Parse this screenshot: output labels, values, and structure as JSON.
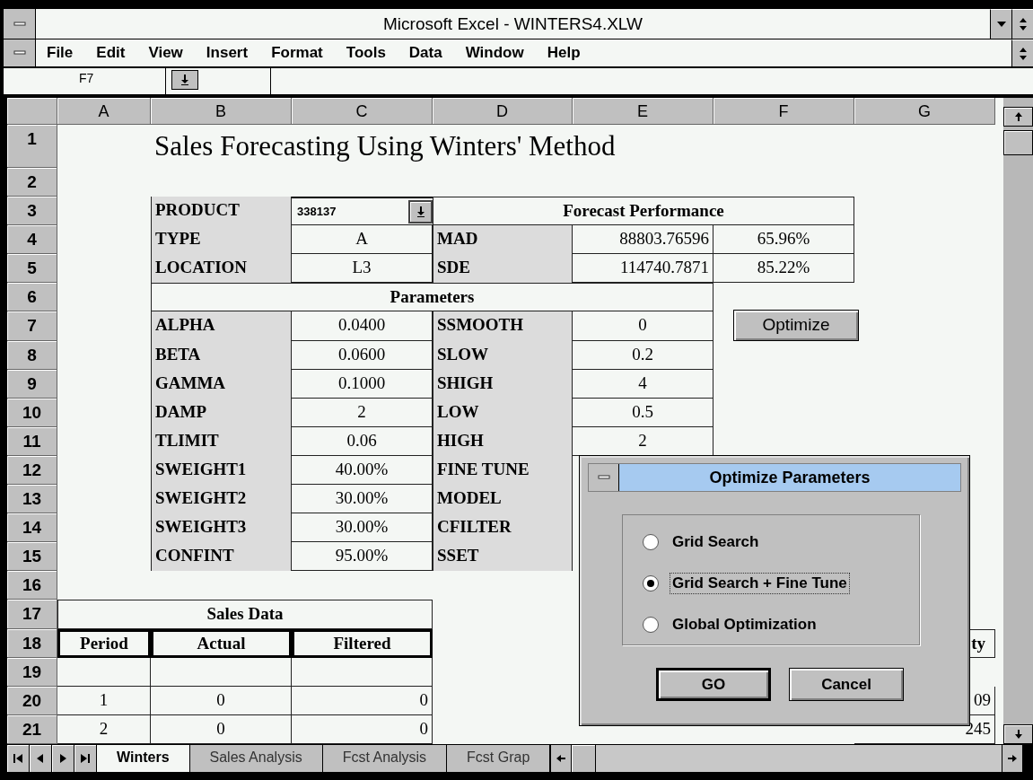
{
  "window": {
    "title": "Microsoft Excel - WINTERS4.XLW"
  },
  "menu": [
    "File",
    "Edit",
    "View",
    "Insert",
    "Format",
    "Tools",
    "Data",
    "Window",
    "Help"
  ],
  "formula_bar": {
    "name_box": "F7"
  },
  "sheet": {
    "columns": [
      "A",
      "B",
      "C",
      "D",
      "E",
      "F",
      "G"
    ],
    "rows": [
      {
        "number": "1",
        "cells": [
          {
            "kind": "empty"
          },
          {
            "kind": "title",
            "text": "Sales Forecasting Using Winters' Method"
          },
          {
            "kind": "merged"
          },
          {
            "kind": "merged"
          },
          {
            "kind": "merged"
          }
        ]
      },
      {
        "number": "2"
      },
      {
        "number": "3",
        "cells": [
          {
            "kind": "empty"
          },
          {
            "kind": "label",
            "text": "PRODUCT"
          },
          {
            "kind": "product",
            "text": "338137"
          },
          {
            "kind": "heading",
            "text": "Forecast Performance"
          },
          {
            "kind": "merged"
          },
          {
            "kind": "merged"
          }
        ]
      },
      {
        "number": "4",
        "cells": [
          {
            "kind": "empty"
          },
          {
            "kind": "label",
            "text": "TYPE"
          },
          {
            "kind": "value",
            "text": "A"
          },
          {
            "kind": "label",
            "text": "MAD"
          },
          {
            "kind": "number",
            "text": "88803.76596"
          },
          {
            "kind": "value",
            "text": "65.96%"
          }
        ]
      },
      {
        "number": "5",
        "cells": [
          {
            "kind": "empty"
          },
          {
            "kind": "label",
            "text": "LOCATION"
          },
          {
            "kind": "value",
            "text": "L3"
          },
          {
            "kind": "label",
            "text": "SDE"
          },
          {
            "kind": "number",
            "text": "114740.7871"
          },
          {
            "kind": "value",
            "text": "85.22%"
          }
        ]
      },
      {
        "number": "6",
        "cells": [
          {
            "kind": "empty"
          },
          {
            "kind": "heading",
            "text": "Parameters"
          },
          {
            "kind": "merged"
          },
          {
            "kind": "merged"
          },
          {
            "kind": "merged"
          }
        ]
      },
      {
        "number": "7",
        "cells": [
          {
            "kind": "empty"
          },
          {
            "kind": "label",
            "text": "ALPHA"
          },
          {
            "kind": "value",
            "text": "0.0400"
          },
          {
            "kind": "label",
            "text": "SSMOOTH"
          },
          {
            "kind": "value",
            "text": "0"
          },
          {
            "kind": "button",
            "text": "Optimize"
          }
        ]
      },
      {
        "number": "8",
        "cells": [
          {
            "kind": "empty"
          },
          {
            "kind": "label",
            "text": "BETA"
          },
          {
            "kind": "value",
            "text": "0.0600"
          },
          {
            "kind": "label",
            "text": "SLOW"
          },
          {
            "kind": "value",
            "text": "0.2"
          }
        ]
      },
      {
        "number": "9",
        "cells": [
          {
            "kind": "empty"
          },
          {
            "kind": "label",
            "text": "GAMMA"
          },
          {
            "kind": "value",
            "text": "0.1000"
          },
          {
            "kind": "label",
            "text": "SHIGH"
          },
          {
            "kind": "value",
            "text": "4"
          }
        ]
      },
      {
        "number": "10",
        "cells": [
          {
            "kind": "empty"
          },
          {
            "kind": "label",
            "text": "DAMP"
          },
          {
            "kind": "value",
            "text": "2"
          },
          {
            "kind": "label",
            "text": "LOW"
          },
          {
            "kind": "value",
            "text": "0.5"
          }
        ]
      },
      {
        "number": "11",
        "cells": [
          {
            "kind": "empty"
          },
          {
            "kind": "label",
            "text": "TLIMIT"
          },
          {
            "kind": "value",
            "text": "0.06"
          },
          {
            "kind": "label",
            "text": "HIGH"
          },
          {
            "kind": "value",
            "text": "2"
          }
        ]
      },
      {
        "number": "12",
        "cells": [
          {
            "kind": "empty"
          },
          {
            "kind": "label",
            "text": "SWEIGHT1"
          },
          {
            "kind": "value",
            "text": "40.00%"
          },
          {
            "kind": "label",
            "text": "FINE TUNE"
          }
        ]
      },
      {
        "number": "13",
        "cells": [
          {
            "kind": "empty"
          },
          {
            "kind": "label",
            "text": "SWEIGHT2"
          },
          {
            "kind": "value",
            "text": "30.00%"
          },
          {
            "kind": "label",
            "text": "MODEL"
          }
        ]
      },
      {
        "number": "14",
        "cells": [
          {
            "kind": "empty"
          },
          {
            "kind": "label",
            "text": "SWEIGHT3"
          },
          {
            "kind": "value",
            "text": "30.00%"
          },
          {
            "kind": "label",
            "text": "CFILTER"
          }
        ]
      },
      {
        "number": "15",
        "cells": [
          {
            "kind": "empty"
          },
          {
            "kind": "label",
            "text": "CONFINT"
          },
          {
            "kind": "value",
            "text": "95.00%"
          },
          {
            "kind": "label",
            "text": "SSET"
          }
        ]
      },
      {
        "number": "16"
      },
      {
        "number": "17",
        "cells": [
          {
            "kind": "heading",
            "text": "Sales Data"
          },
          {
            "kind": "merged"
          },
          {
            "kind": "merged"
          }
        ]
      },
      {
        "number": "18",
        "cells": [
          {
            "kind": "column-header",
            "text": "Period"
          },
          {
            "kind": "column-header",
            "text": "Actual"
          },
          {
            "kind": "column-header",
            "text": "Filtered"
          },
          {
            "kind": "empty"
          },
          {
            "kind": "empty"
          },
          {
            "kind": "empty"
          },
          {
            "kind": "partial-header",
            "text": "ty"
          }
        ]
      },
      {
        "number": "19",
        "cells": [
          {
            "kind": "box"
          },
          {
            "kind": "box"
          },
          {
            "kind": "box"
          }
        ]
      },
      {
        "number": "20",
        "cells": [
          {
            "kind": "value",
            "text": "1"
          },
          {
            "kind": "value",
            "text": "0"
          },
          {
            "kind": "number",
            "text": "0"
          },
          {
            "kind": "empty"
          },
          {
            "kind": "empty"
          },
          {
            "kind": "empty"
          },
          {
            "kind": "number",
            "text": "09"
          }
        ]
      },
      {
        "number": "21",
        "cells": [
          {
            "kind": "value",
            "text": "2"
          },
          {
            "kind": "value",
            "text": "0"
          },
          {
            "kind": "number",
            "text": "0"
          },
          {
            "kind": "empty"
          },
          {
            "kind": "empty"
          },
          {
            "kind": "empty"
          },
          {
            "kind": "number",
            "text": "245"
          }
        ]
      }
    ]
  },
  "sheet_tabs": [
    {
      "label": "Winters",
      "selected": true
    },
    {
      "label": "Sales Analysis",
      "selected": false
    },
    {
      "label": "Fcst Analysis",
      "selected": false
    },
    {
      "label": "Fcst Grap",
      "selected": false
    }
  ],
  "dialog": {
    "title": "Optimize Parameters",
    "options": [
      {
        "label": "Grid Search",
        "selected": false
      },
      {
        "label": "Grid Search + Fine Tune",
        "selected": true
      },
      {
        "label": "Global Optimization",
        "selected": false
      }
    ],
    "buttons": [
      {
        "label": "GO",
        "default": true
      },
      {
        "label": "Cancel",
        "default": false
      }
    ]
  }
}
